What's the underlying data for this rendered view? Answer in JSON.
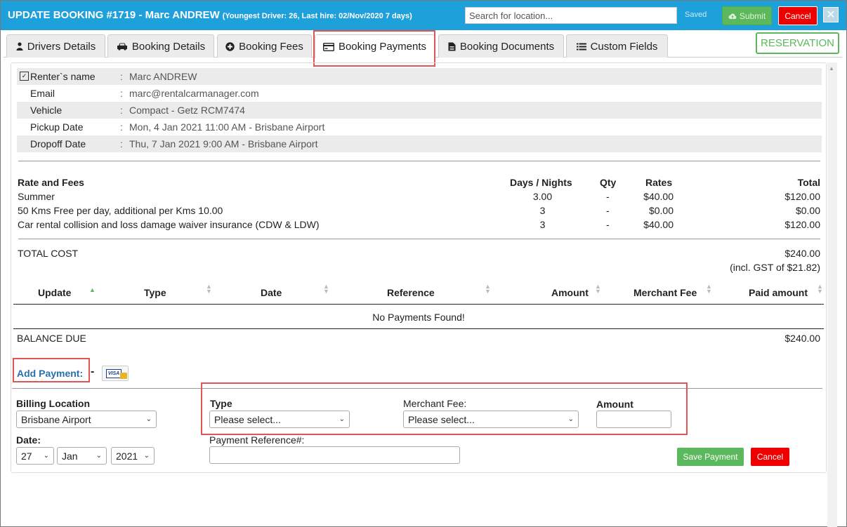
{
  "header": {
    "title": "UPDATE BOOKING #1719  - Marc ANDREW",
    "subtitle": "(Youngest Driver: 26, Last hire: 02/Nov/2020 7 days)",
    "search_placeholder": "Search for location...",
    "saved_label": "Saved",
    "submit_label": "Submit",
    "cancel_label": "Cancel",
    "close_label": "✕"
  },
  "tabs": [
    {
      "label": "Drivers Details",
      "icon": "user-icon"
    },
    {
      "label": "Booking Details",
      "icon": "car-icon"
    },
    {
      "label": "Booking Fees",
      "icon": "plus-circle-icon"
    },
    {
      "label": "Booking Payments",
      "icon": "credit-card-icon",
      "active": true
    },
    {
      "label": "Booking Documents",
      "icon": "document-icon"
    },
    {
      "label": "Custom Fields",
      "icon": "list-icon"
    }
  ],
  "reservation_label": "RESERVATION",
  "info": [
    {
      "label": "Renter`s name",
      "value": "Marc ANDREW"
    },
    {
      "label": "Email",
      "value": "marc@rentalcarmanager.com"
    },
    {
      "label": "Vehicle",
      "value": "Compact - Getz RCM7474"
    },
    {
      "label": "Pickup Date",
      "value": "Mon, 4 Jan 2021 11:00 AM - Brisbane Airport"
    },
    {
      "label": "Dropoff Date",
      "value": "Thu, 7 Jan 2021 9:00 AM - Brisbane Airport"
    }
  ],
  "fees": {
    "headers": {
      "name": "Rate and Fees",
      "days": "Days / Nights",
      "qty": "Qty",
      "rates": "Rates",
      "total": "Total"
    },
    "rows": [
      {
        "name": "Summer",
        "days": "3.00",
        "qty": "-",
        "rates": "$40.00",
        "total": "$120.00"
      },
      {
        "name": "50 Kms Free per day, additional per Kms 10.00",
        "days": "3",
        "qty": "-",
        "rates": "$0.00",
        "total": "$0.00"
      },
      {
        "name": "Car rental collision and loss damage waiver insurance (CDW & LDW)",
        "days": "3",
        "qty": "-",
        "rates": "$40.00",
        "total": "$120.00"
      }
    ],
    "total_label": "TOTAL COST",
    "total_value": "$240.00",
    "gst_note": "(incl. GST of $21.82)"
  },
  "payments": {
    "headers": [
      "Update",
      "Type",
      "Date",
      "Reference",
      "Amount",
      "Merchant Fee",
      "Paid amount"
    ],
    "empty_text": "No Payments Found!",
    "balance_label": "BALANCE DUE",
    "balance_value": "$240.00"
  },
  "add_payment": {
    "link_label": "Add Payment:",
    "dash": "-",
    "card_text": "VISA",
    "billing_location_label": "Billing Location",
    "billing_location_value": "Brisbane Airport",
    "type_label": "Type",
    "type_value": "Please select...",
    "merchant_fee_label": "Merchant Fee:",
    "merchant_fee_value": "Please select...",
    "amount_label": "Amount",
    "amount_value": "",
    "date_label": "Date:",
    "date_day": "27",
    "date_month": "Jan",
    "date_year": "2021",
    "reference_label": "Payment Reference#:",
    "reference_value": "",
    "save_label": "Save Payment",
    "cancel_label": "Cancel"
  },
  "colors": {
    "header_bg": "#1ea0db",
    "success": "#5cb85c",
    "danger": "#ee0000",
    "highlight": "#e25555",
    "link": "#2a6fb0"
  }
}
